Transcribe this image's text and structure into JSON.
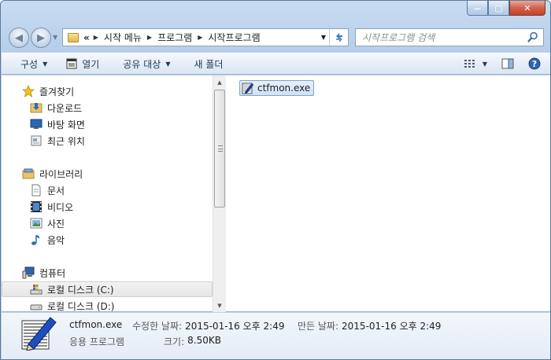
{
  "window": {
    "minimize_glyph": "—",
    "maximize_glyph": "▢",
    "close_glyph": "✕"
  },
  "address": {
    "overflow": "«",
    "crumbs": [
      "시작 메뉴",
      "프로그램",
      "시작프로그램"
    ]
  },
  "search": {
    "placeholder": "시작프로그램 검색"
  },
  "toolbar": {
    "organize": "구성",
    "open": "열기",
    "share": "공유 대상",
    "new_folder": "새 폴더"
  },
  "nav": {
    "favorites": "즐겨찾기",
    "downloads": "다운로드",
    "desktop": "바탕 화면",
    "recent": "최근 위치",
    "libraries": "라이브러리",
    "documents": "문서",
    "videos": "비디오",
    "pictures": "사진",
    "music": "음악",
    "computer": "컴퓨터",
    "disk_c": "로컬 디스크 (C:)",
    "disk_d": "로컬 디스크 (D:)"
  },
  "files": [
    {
      "name": "ctfmon.exe"
    }
  ],
  "details": {
    "name": "ctfmon.exe",
    "type": "응용 프로그램",
    "modified_label": "수정한 날짜:",
    "modified_value": "2015-01-16 오후 2:49",
    "created_label": "만든 날짜:",
    "created_value": "2015-01-16 오후 2:49",
    "size_label": "크기:",
    "size_value": "8.50KB"
  },
  "colors": {
    "frame": "#b9d1eb",
    "selection": "#cfe2f7",
    "toolbar_text": "#1e395b"
  }
}
